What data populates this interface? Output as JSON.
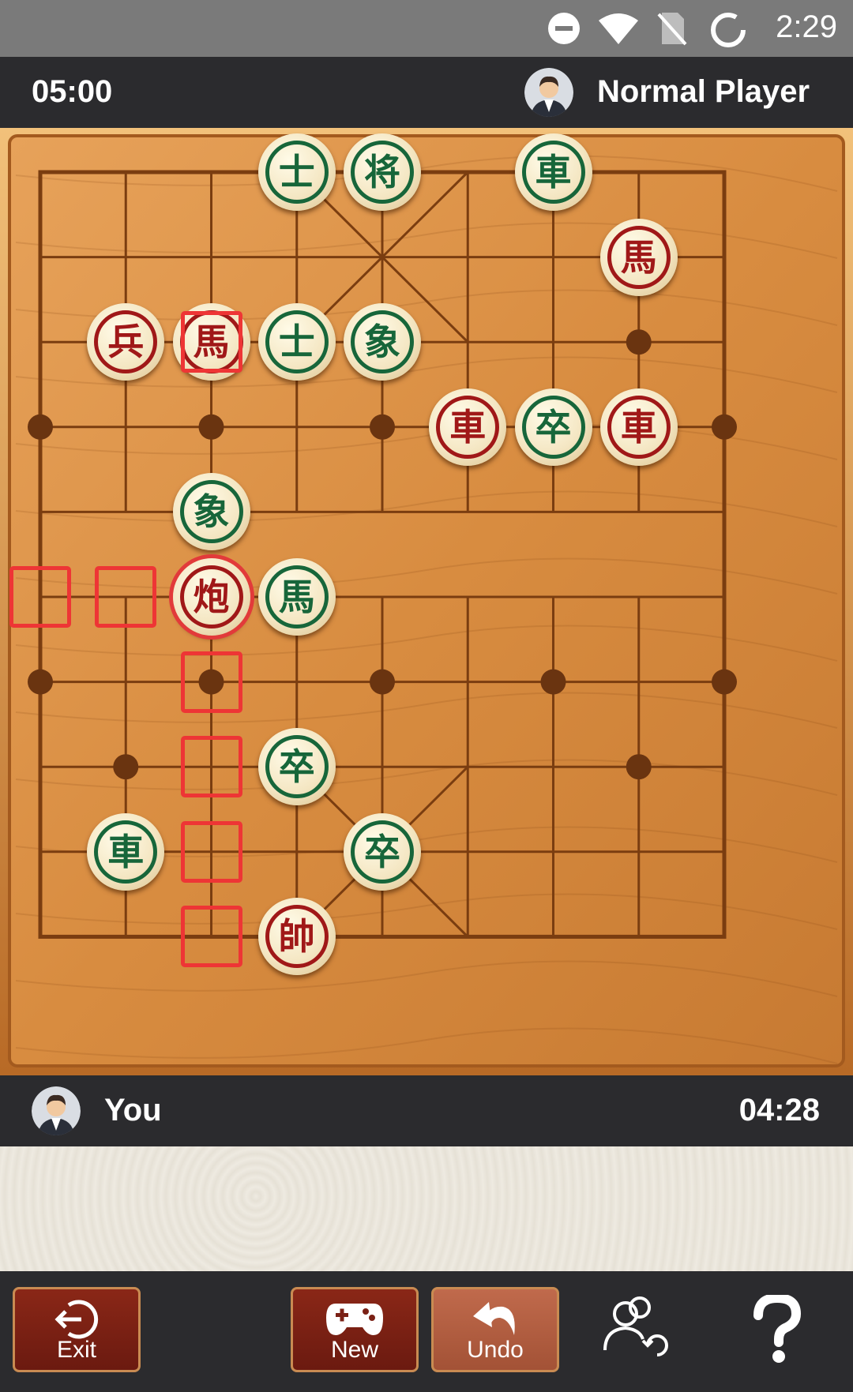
{
  "status_bar": {
    "time": "2:29",
    "icons": [
      "do-not-disturb-icon",
      "wifi-icon",
      "no-sim-icon",
      "loading-icon"
    ]
  },
  "opponent": {
    "timer": "05:00",
    "name": "Normal Player",
    "avatar_icon": "avatar-icon"
  },
  "player": {
    "name": "You",
    "timer": "04:28",
    "avatar_icon": "avatar-icon"
  },
  "board": {
    "columns": 9,
    "rows": 10,
    "selected_piece": {
      "col": 2,
      "row": 5
    },
    "pieces": [
      {
        "glyph": "士",
        "side": "green",
        "col": 3,
        "row": 0
      },
      {
        "glyph": "将",
        "side": "green",
        "col": 4,
        "row": 0
      },
      {
        "glyph": "車",
        "side": "green",
        "col": 6,
        "row": 0
      },
      {
        "glyph": "馬",
        "side": "red",
        "col": 7,
        "row": 1
      },
      {
        "glyph": "兵",
        "side": "red",
        "col": 1,
        "row": 2
      },
      {
        "glyph": "馬",
        "side": "red",
        "col": 2,
        "row": 2
      },
      {
        "glyph": "士",
        "side": "green",
        "col": 3,
        "row": 2
      },
      {
        "glyph": "象",
        "side": "green",
        "col": 4,
        "row": 2
      },
      {
        "glyph": "車",
        "side": "red",
        "col": 5,
        "row": 3
      },
      {
        "glyph": "卒",
        "side": "green",
        "col": 6,
        "row": 3
      },
      {
        "glyph": "車",
        "side": "red",
        "col": 7,
        "row": 3
      },
      {
        "glyph": "象",
        "side": "green",
        "col": 2,
        "row": 4
      },
      {
        "glyph": "炮",
        "side": "red",
        "col": 2,
        "row": 5
      },
      {
        "glyph": "馬",
        "side": "green",
        "col": 3,
        "row": 5
      },
      {
        "glyph": "卒",
        "side": "green",
        "col": 3,
        "row": 7
      },
      {
        "glyph": "車",
        "side": "green",
        "col": 1,
        "row": 8
      },
      {
        "glyph": "卒",
        "side": "green",
        "col": 4,
        "row": 8
      },
      {
        "glyph": "帥",
        "side": "red",
        "col": 3,
        "row": 9
      }
    ],
    "move_markers": [
      {
        "col": 2,
        "row": 2
      },
      {
        "col": 0,
        "row": 5
      },
      {
        "col": 1,
        "row": 5
      },
      {
        "col": 2,
        "row": 6
      },
      {
        "col": 2,
        "row": 7
      },
      {
        "col": 2,
        "row": 8
      },
      {
        "col": 2,
        "row": 9
      }
    ]
  },
  "toolbar": {
    "exit_label": "Exit",
    "new_label": "New",
    "undo_label": "Undo",
    "switch_icon": "switch-players-icon",
    "help_icon": "help-icon"
  },
  "colors": {
    "red_piece": "#a01818",
    "green_piece": "#17663a",
    "marker": "#ee3535",
    "button": "#7a2015"
  }
}
